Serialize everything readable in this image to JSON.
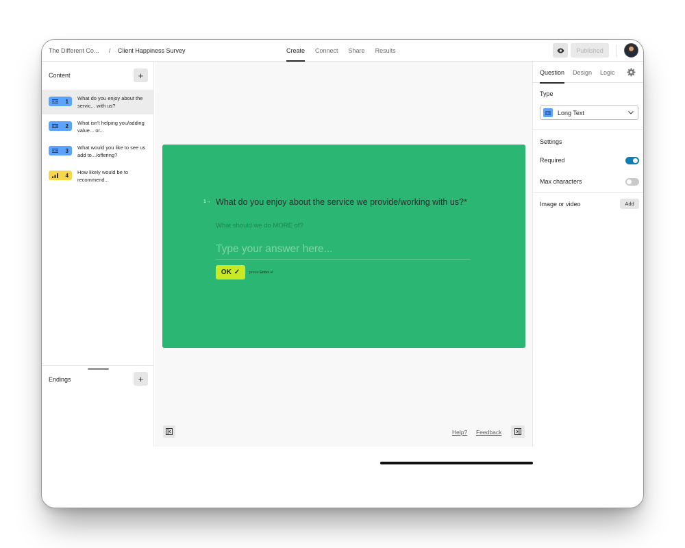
{
  "header": {
    "workspace": "The Different Co...",
    "separator": "/",
    "form_title": "Client Happiness Survey",
    "tabs": [
      {
        "label": "Create",
        "active": true
      },
      {
        "label": "Connect",
        "active": false
      },
      {
        "label": "Share",
        "active": false
      },
      {
        "label": "Results",
        "active": false
      }
    ],
    "preview_icon": "eye-icon",
    "publish_label": "Published"
  },
  "sidebar": {
    "content_title": "Content",
    "add_label": "+",
    "questions": [
      {
        "number": "1",
        "text": "What do you enjoy about the servic... with us?",
        "icon": "long-text-icon",
        "color": "#5aa3ff",
        "selected": true
      },
      {
        "number": "2",
        "text": "What isn't helping you/adding value... or...",
        "icon": "long-text-icon",
        "color": "#5aa3ff",
        "selected": false
      },
      {
        "number": "3",
        "text": "What would you like to see us add to.../offering?",
        "icon": "long-text-icon",
        "color": "#5aa3ff",
        "selected": false
      },
      {
        "number": "4",
        "text": "How likely would be to recommend...",
        "icon": "opinion-scale-icon",
        "color": "#f7d64a",
        "selected": false
      }
    ],
    "endings_title": "Endings"
  },
  "canvas": {
    "background": "#2bb673",
    "question_number": "1",
    "question_arrow": "→",
    "question_title": "What do you enjoy about the service we provide/working with us?*",
    "question_description": "What should we do MORE of?",
    "answer_placeholder": "Type your answer here...",
    "ok_label": "OK",
    "ok_check": "✓",
    "press_hint": "press",
    "press_key": "Enter ↵",
    "help_label": "Help?",
    "feedback_label": "Feedback"
  },
  "panel": {
    "tabs": [
      {
        "label": "Question",
        "active": true
      },
      {
        "label": "Design",
        "active": false
      },
      {
        "label": "Logic",
        "active": false
      }
    ],
    "type_label": "Type",
    "type_value": "Long Text",
    "settings_label": "Settings",
    "required_label": "Required",
    "required_on": true,
    "max_chars_label": "Max characters",
    "max_chars_on": false,
    "media_label": "Image or video",
    "add_label": "Add"
  },
  "colors": {
    "accent_toggle": "#0e7fb0",
    "ok_button": "#c8ea25",
    "badge_text": "#5aa3ff",
    "badge_scale": "#f7d64a"
  }
}
